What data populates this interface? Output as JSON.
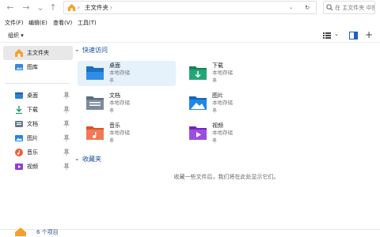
{
  "address": {
    "segments": [
      "主文件夹"
    ],
    "search_placeholder": "在 主文件夹 中搜索"
  },
  "menu": [
    "文件(F)",
    "编辑(E)",
    "查看(V)",
    "工具(T)"
  ],
  "toolbar": {
    "organize_label": "组织 ▾"
  },
  "sidebar": {
    "items": [
      {
        "label": "主文件夹",
        "icon": "home-icon",
        "active": true
      },
      {
        "label": "图库",
        "icon": "gallery-icon"
      },
      {
        "label": "桌面",
        "icon": "desktop-icon",
        "pinned": true
      },
      {
        "label": "下载",
        "icon": "downloads-icon",
        "pinned": true
      },
      {
        "label": "文档",
        "icon": "documents-icon",
        "pinned": true
      },
      {
        "label": "图片",
        "icon": "pictures-icon",
        "pinned": true
      },
      {
        "label": "音乐",
        "icon": "music-icon",
        "pinned": true
      },
      {
        "label": "视频",
        "icon": "videos-icon",
        "pinned": true
      }
    ]
  },
  "quick_access": {
    "title": "快速访问",
    "tiles": [
      {
        "name": "桌面",
        "sub": "本地存储",
        "icon": "desktop-folder-icon",
        "selected": true
      },
      {
        "name": "下载",
        "sub": "本地存储",
        "icon": "downloads-folder-icon"
      },
      {
        "name": "文档",
        "sub": "本地存储",
        "icon": "documents-folder-icon"
      },
      {
        "name": "图片",
        "sub": "本地存储",
        "icon": "pictures-folder-icon"
      },
      {
        "name": "音乐",
        "sub": "本地存储",
        "icon": "music-folder-icon"
      },
      {
        "name": "视频",
        "sub": "本地存储",
        "icon": "videos-folder-icon"
      }
    ]
  },
  "favorites": {
    "title": "收藏夹",
    "empty_message": "收藏一些文件后，我们将在此处显示它们。"
  },
  "status": {
    "text": "6 个项目"
  },
  "colors": {
    "accent": "#0067c0",
    "selected_bg": "#e5f1fb",
    "section_text": "#1a4a9a"
  }
}
